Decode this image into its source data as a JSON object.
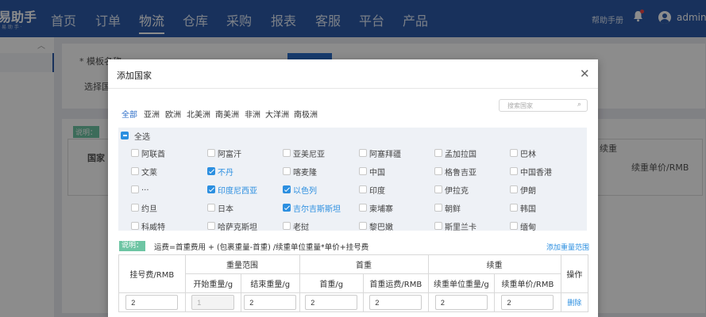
{
  "app": {
    "logo": "易助手",
    "logo_sub": "易 助 手 ·"
  },
  "nav": [
    "首页",
    "订单",
    "物流",
    "仓库",
    "采购",
    "报表",
    "客服",
    "平台",
    "产品"
  ],
  "nav_active": "物流",
  "header": {
    "help": "帮助手册",
    "user": "admin"
  },
  "background": {
    "template_name_label": "* 模板名称",
    "country_label": "选择国",
    "note_badge": "说明：",
    "country_col": "国家",
    "extra_col": "续重",
    "extra_price_col": "续重单价/RMB"
  },
  "modal": {
    "title": "添加国家",
    "search_placeholder": "搜索国家",
    "regions": [
      "全部",
      "亚洲",
      "欧洲",
      "北美洲",
      "南美洲",
      "非洲",
      "大洋洲",
      "南极洲"
    ],
    "active_region": "全部",
    "select_all": "全选",
    "countries": [
      [
        "阿联酋",
        "阿富汗",
        "亚美尼亚",
        "阿塞拜疆",
        "孟加拉国",
        "巴林"
      ],
      [
        "文莱",
        "不丹",
        "喀麦隆",
        "中国",
        "格鲁吉亚",
        "中国香港"
      ],
      [
        "...",
        "印度尼西亚",
        "以色列",
        "印度",
        "伊拉克",
        "伊朗"
      ],
      [
        "约旦",
        "日本",
        "吉尔吉斯斯坦",
        "柬埔寨",
        "朝鲜",
        "韩国"
      ],
      [
        "科威特",
        "哈萨克斯坦",
        "老挝",
        "黎巴嫩",
        "斯里兰卡",
        "缅甸"
      ]
    ],
    "checked": [
      "不丹",
      "印度尼西亚",
      "以色列",
      "吉尔吉斯斯坦"
    ],
    "note_label": "说明：",
    "note_text": "运费=首重费用 + (包裹重量-首重) /续重单位重量*单价+挂号费",
    "add_range": "添加重量范围",
    "table": {
      "reg_fee": "挂号费/RMB",
      "weight_range": "重量范围",
      "first_weight": "首重",
      "extra_weight": "续重",
      "action": "操作",
      "start_weight": "开始重量/g",
      "end_weight": "结束重量/g",
      "first_weight_g": "首重/g",
      "first_fee": "首重运费/RMB",
      "extra_unit": "续重单位重量/g",
      "extra_price": "续重单价/RMB",
      "row": {
        "reg_fee": "2",
        "start": "1",
        "end": "2",
        "first_g": "2",
        "first_fee": "2",
        "extra_unit": "2",
        "extra_price": "2",
        "delete": "删除"
      }
    }
  },
  "colors": {
    "topbar": "#2c5aa8",
    "accent": "#2c8fe0",
    "note_badge": "#6ec5a4"
  }
}
